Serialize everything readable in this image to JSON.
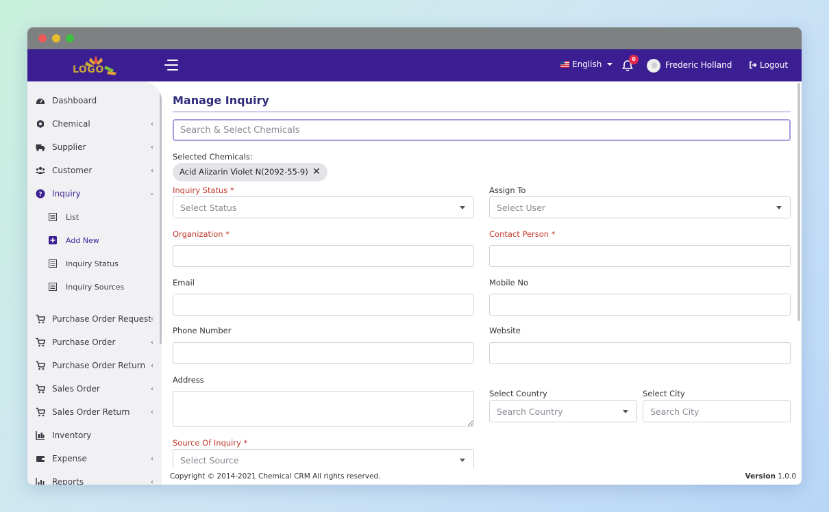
{
  "topbar": {
    "logo_text": "LOGO",
    "language": "English",
    "notification_count": "0",
    "user_name": "Frederic Holland",
    "logout_label": "Logout"
  },
  "sidebar": {
    "items": [
      {
        "label": "Dashboard",
        "icon": "dashboard-icon",
        "has_chevron": false
      },
      {
        "label": "Chemical",
        "icon": "chemical-icon",
        "has_chevron": true
      },
      {
        "label": "Supplier",
        "icon": "truck-icon",
        "has_chevron": true
      },
      {
        "label": "Customer",
        "icon": "users-icon",
        "has_chevron": true
      },
      {
        "label": "Inquiry",
        "icon": "question-icon",
        "has_chevron": true,
        "expanded": true
      }
    ],
    "sub_items": [
      {
        "label": "List",
        "icon": "list-icon"
      },
      {
        "label": "Add New",
        "icon": "plus-square-icon",
        "active": true
      },
      {
        "label": "Inquiry Status",
        "icon": "list-icon"
      },
      {
        "label": "Inquiry Sources",
        "icon": "list-icon"
      }
    ],
    "items_after": [
      {
        "label": "Purchase Order Request",
        "icon": "cart-icon"
      },
      {
        "label": "Purchase Order",
        "icon": "cart-icon"
      },
      {
        "label": "Purchase Order Return",
        "icon": "cart-icon"
      },
      {
        "label": "Sales Order",
        "icon": "cart-icon"
      },
      {
        "label": "Sales Order Return",
        "icon": "cart-icon"
      },
      {
        "label": "Inventory",
        "icon": "inventory-icon"
      },
      {
        "label": "Expense",
        "icon": "wallet-icon"
      },
      {
        "label": "Reports",
        "icon": "chart-icon"
      }
    ]
  },
  "form": {
    "title": "Manage Inquiry",
    "chemical_search_placeholder": "Search & Select Chemicals",
    "selected_chemicals_label": "Selected Chemicals:",
    "selected_chemical": "Acid Alizarin Violet N(2092-55-9)",
    "inquiry_status_label": "Inquiry Status *",
    "inquiry_status_placeholder": "Select Status",
    "assign_to_label": "Assign To",
    "assign_to_placeholder": "Select User",
    "organization_label": "Organization *",
    "contact_person_label": "Contact Person *",
    "email_label": "Email",
    "mobile_label": "Mobile No",
    "phone_label": "Phone Number",
    "website_label": "Website",
    "address_label": "Address",
    "country_label": "Select Country",
    "country_placeholder": "Search Country",
    "city_label": "Select City",
    "city_placeholder": "Search City",
    "source_label": "Source Of Inquiry *",
    "source_placeholder": "Select Source"
  },
  "footer": {
    "copyright": "Copyright © 2014-2021 Chemical CRM All rights reserved.",
    "version_label": "Version",
    "version_value": "1.0.0"
  },
  "colors": {
    "brand": "#3b1f92",
    "required": "#c0392b",
    "titlebar": "#7d8181"
  }
}
